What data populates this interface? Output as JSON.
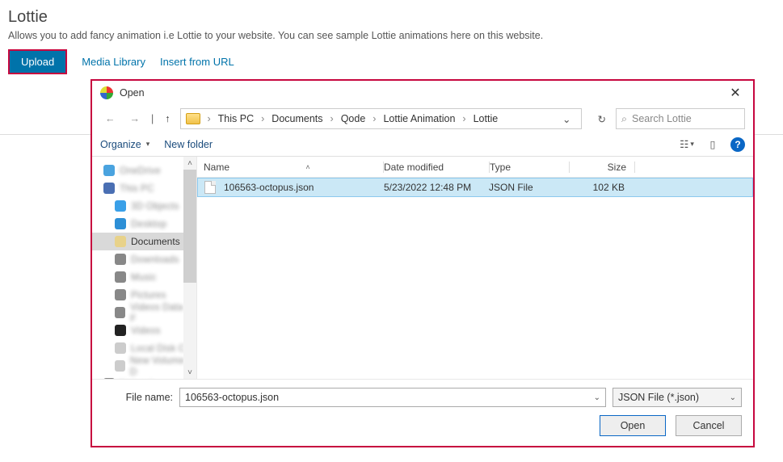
{
  "page": {
    "title": "Lottie",
    "description": "Allows you to add fancy animation i.e Lottie to your website. You can see sample Lottie animations here on this website.",
    "tabs": {
      "upload": "Upload",
      "media": "Media Library",
      "url": "Insert from URL"
    }
  },
  "dialog": {
    "title": "Open",
    "breadcrumb": [
      "This PC",
      "Documents",
      "Qode",
      "Lottie Animation",
      "Lottie"
    ],
    "search_placeholder": "Search Lottie",
    "toolbar": {
      "organize": "Organize",
      "new_folder": "New folder"
    },
    "nav": {
      "items": [
        {
          "label": "OneDrive",
          "color": "#4aa3df",
          "blur": true
        },
        {
          "label": "This PC",
          "color": "#4a6fb3",
          "blur": true
        },
        {
          "label": "3D Objects",
          "color": "#3aa0e8",
          "blur": true,
          "indent": true
        },
        {
          "label": "Desktop",
          "color": "#2d8fd6",
          "blur": true,
          "indent": true
        },
        {
          "label": "Documents",
          "color": "#e8d28a",
          "blur": false,
          "indent": true,
          "selected": true
        },
        {
          "label": "Downloads",
          "color": "#888",
          "blur": true,
          "indent": true
        },
        {
          "label": "Music",
          "color": "#888",
          "blur": true,
          "indent": true
        },
        {
          "label": "Pictures",
          "color": "#888",
          "blur": true,
          "indent": true
        },
        {
          "label": "Videos Data F",
          "color": "#888",
          "blur": true,
          "indent": true
        },
        {
          "label": "Videos",
          "color": "#222",
          "blur": true,
          "indent": true
        },
        {
          "label": "Local Disk C",
          "color": "#ccc",
          "blur": true,
          "indent": true
        },
        {
          "label": "New Volume D",
          "color": "#ccc",
          "blur": true,
          "indent": true
        },
        {
          "label": "Network",
          "color": "#888",
          "blur": true
        }
      ]
    },
    "columns": {
      "name": "Name",
      "date": "Date modified",
      "type": "Type",
      "size": "Size"
    },
    "files": [
      {
        "name": "106563-octopus.json",
        "date": "5/23/2022 12:48 PM",
        "type": "JSON File",
        "size": "102 KB"
      }
    ],
    "filename_label": "File name:",
    "filename_value": "106563-octopus.json",
    "filetype_value": "JSON File (*.json)",
    "buttons": {
      "open": "Open",
      "cancel": "Cancel"
    }
  }
}
